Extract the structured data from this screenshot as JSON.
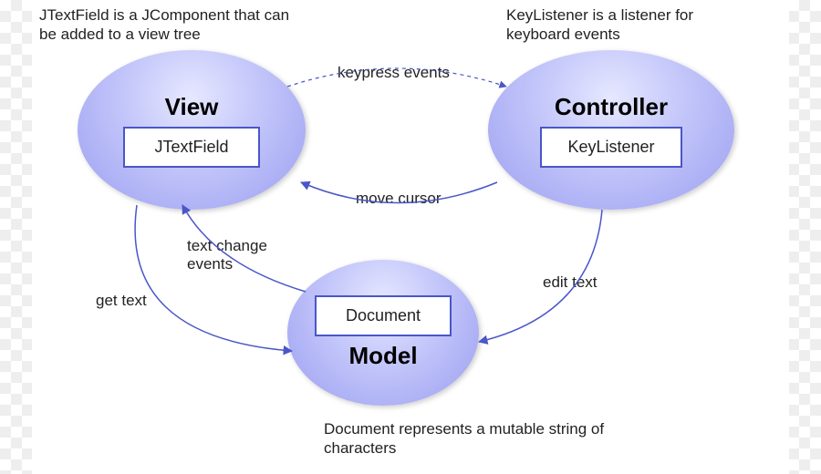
{
  "diagram": {
    "view": {
      "title": "View",
      "box": "JTextField",
      "caption": "JTextField is a JComponent that can be added to a view tree"
    },
    "controller": {
      "title": "Controller",
      "box": "KeyListener",
      "caption": "KeyListener is a listener for keyboard events"
    },
    "model": {
      "title": "Model",
      "box": "Document",
      "caption": "Document represents a mutable string of characters"
    },
    "edges": {
      "view_to_controller": "keypress events",
      "controller_to_view": "move cursor",
      "controller_to_model": "edit text",
      "model_to_view": "text change events",
      "view_to_model": "get text"
    }
  }
}
